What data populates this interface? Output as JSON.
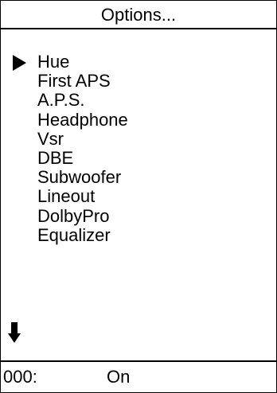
{
  "header": {
    "title": "Options..."
  },
  "menu": {
    "items": [
      {
        "label": "Hue",
        "selected": true
      },
      {
        "label": "First APS",
        "selected": false
      },
      {
        "label": "A.P.S.",
        "selected": false
      },
      {
        "label": "Headphone",
        "selected": false
      },
      {
        "label": "Vsr",
        "selected": false
      },
      {
        "label": "DBE",
        "selected": false
      },
      {
        "label": "Subwoofer",
        "selected": false
      },
      {
        "label": "Lineout",
        "selected": false
      },
      {
        "label": "DolbyPro",
        "selected": false
      },
      {
        "label": "Equalizer",
        "selected": false
      }
    ],
    "cursor_icon": "triangle-right-icon",
    "scroll_icon": "arrow-down-icon"
  },
  "status": {
    "index": "000:",
    "value": "On"
  },
  "colors": {
    "foreground": "#000000",
    "background": "#ffffff"
  }
}
